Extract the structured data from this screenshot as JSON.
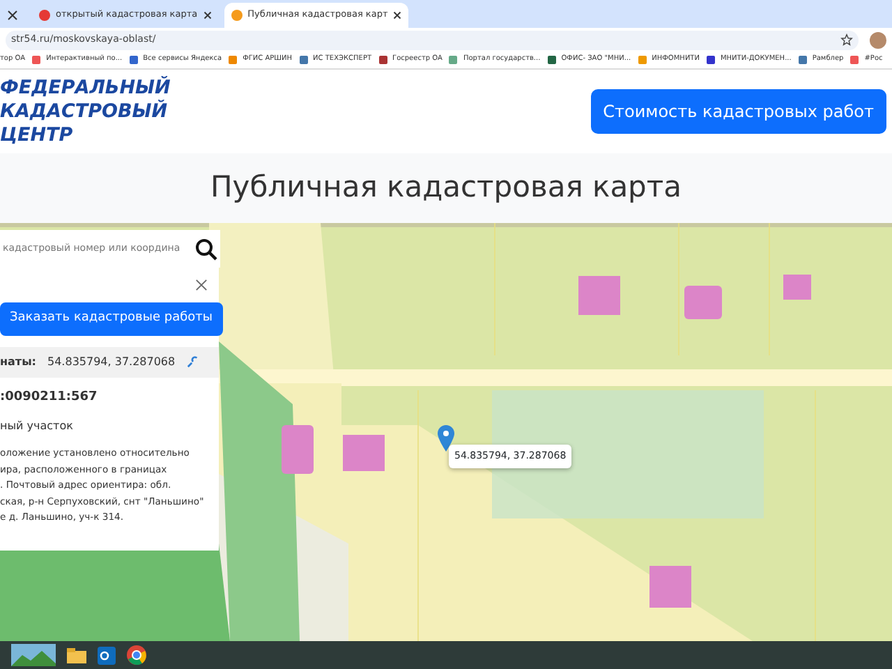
{
  "browser": {
    "tabs": [
      {
        "title": "открытый кадастровая карта",
        "selected": false
      },
      {
        "title": "Публичная кадастровая карт",
        "selected": true
      }
    ],
    "url": "str54.ru/moskovskaya-oblast/",
    "bookmarks": [
      "тор ОА",
      "Интерактивный по...",
      "Все сервисы Яндекса",
      "ФГИС АРШИН",
      "ИС ТЕХЭКСПЕРТ",
      "Госреестр ОА",
      "Портал государств...",
      "ОФИС- ЗАО \"МНИ...",
      "ИНФОМНИТИ",
      "МНИТИ-ДОКУМЕН...",
      "Рамблер",
      "#Рос"
    ]
  },
  "site": {
    "logo_lines": [
      "ФЕДЕРАЛЬНЫЙ",
      "КАДАСТРОВЫЙ",
      "ЦЕНТР"
    ],
    "cost_button": "Стоимость кадастровых работ",
    "page_title": "Публичная кадастровая карта"
  },
  "map": {
    "search": {
      "placeholder": "кадастровый номер или координа"
    },
    "panel": {
      "order_button": "Заказать кадастровые работы",
      "coordinates_label": "наты:",
      "coordinates_value": "54.835794, 37.287068",
      "cadastral_number": ":0090211:567",
      "object_type": "ный участок",
      "address_lines": [
        "оложение установлено относительно",
        "ира, расположенного в границах",
        ". Почтовый адрес ориентира: обл.",
        "ская, р-н Серпуховский, снт \"Ланьшино\"",
        "е д. Ланьшино, уч-к 314."
      ]
    },
    "marker_label": "54.835794, 37.287068"
  }
}
